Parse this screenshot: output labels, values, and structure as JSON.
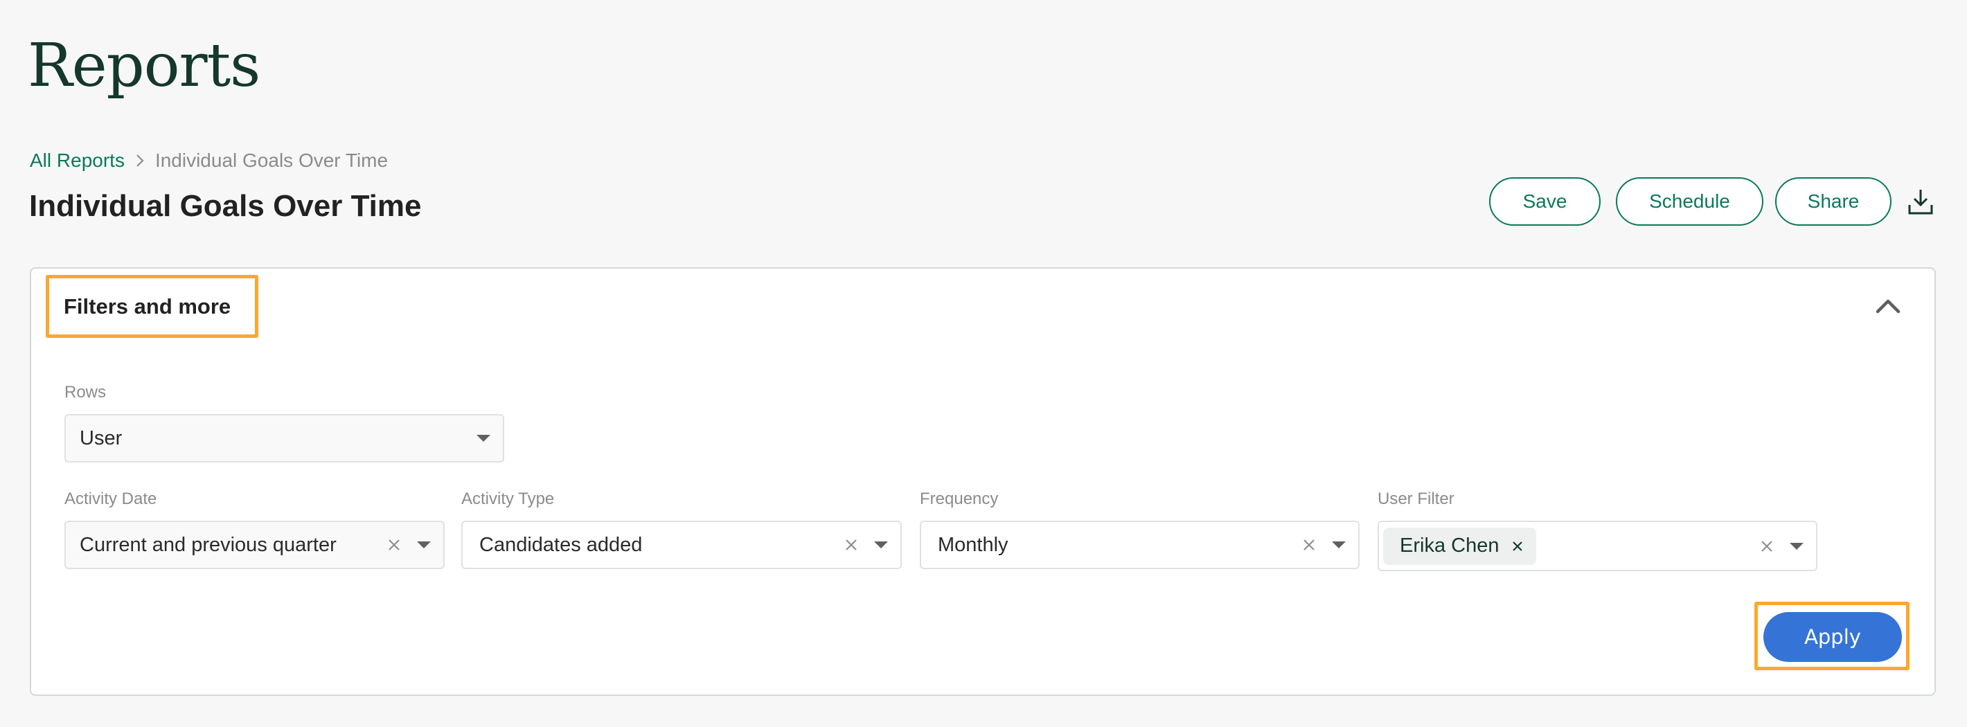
{
  "page": {
    "heading": "Reports"
  },
  "breadcrumb": {
    "items": [
      {
        "label": "All Reports",
        "link": true
      },
      {
        "label": "Individual Goals Over Time",
        "link": false
      }
    ],
    "separator_icon": "chevron-right-icon"
  },
  "report": {
    "title": "Individual Goals Over Time"
  },
  "actions": {
    "save_label": "Save",
    "schedule_label": "Schedule",
    "share_label": "Share",
    "download_icon": "download-icon"
  },
  "filters_panel": {
    "heading": "Filters and more",
    "expanded": true,
    "toggle_icon": "chevron-up-icon",
    "rows": {
      "label": "Rows",
      "value": "User"
    },
    "fields": [
      {
        "label": "Activity Date",
        "value": "Current and previous quarter",
        "clearable": true
      },
      {
        "label": "Activity Type",
        "value": "Candidates added",
        "clearable": true
      },
      {
        "label": "Frequency",
        "value": "Monthly",
        "clearable": true
      },
      {
        "label": "User Filter",
        "chips": [
          "Erika Chen"
        ],
        "clearable": true
      }
    ],
    "apply_label": "Apply"
  },
  "colors": {
    "brand_green": "#0a7a57",
    "heading_green": "#15372c",
    "primary_blue": "#3574d6",
    "highlight_orange": "#ffa630"
  }
}
